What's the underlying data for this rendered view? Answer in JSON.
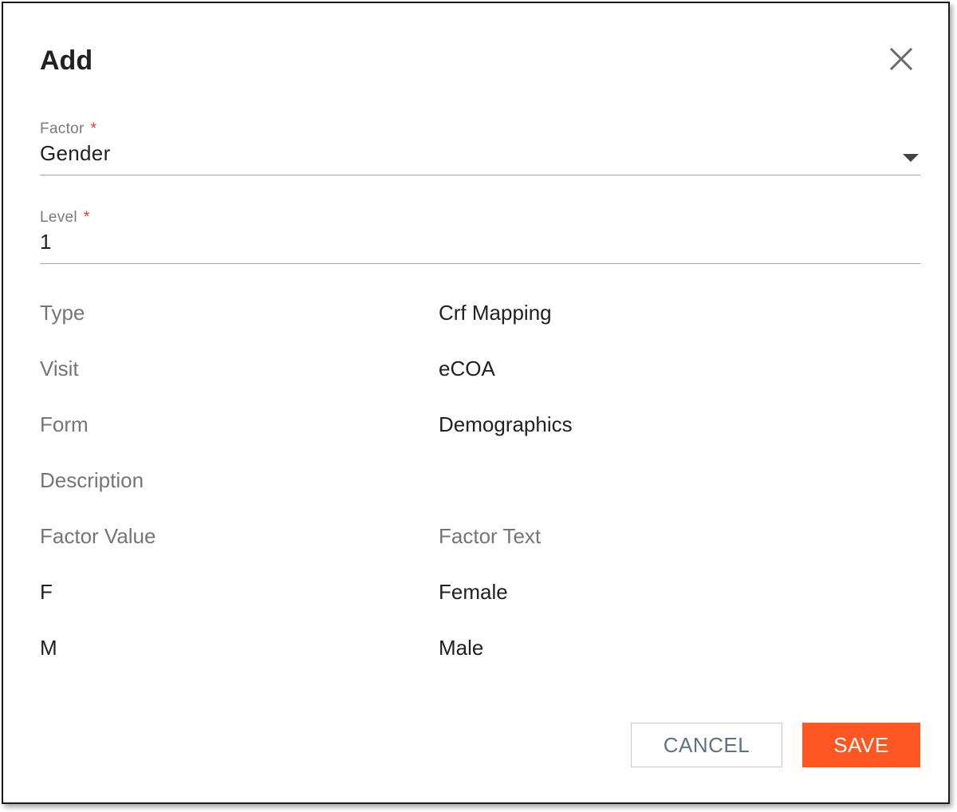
{
  "dialog": {
    "title": "Add",
    "close_icon": "close-icon"
  },
  "factor_field": {
    "label": "Factor",
    "required_mark": "*",
    "value": "Gender",
    "dropdown_icon": "caret-down-icon"
  },
  "level_field": {
    "label": "Level",
    "required_mark": "*",
    "value": "1"
  },
  "details": [
    {
      "label": "Type",
      "value": "Crf Mapping"
    },
    {
      "label": "Visit",
      "value": "eCOA"
    },
    {
      "label": "Form",
      "value": "Demographics"
    },
    {
      "label": "Description",
      "value": ""
    }
  ],
  "factor_table": {
    "headers": {
      "value": "Factor Value",
      "text": "Factor Text"
    },
    "rows": [
      {
        "value": "F",
        "text": "Female"
      },
      {
        "value": "M",
        "text": "Male"
      }
    ]
  },
  "actions": {
    "cancel_label": "CANCEL",
    "save_label": "SAVE"
  },
  "colors": {
    "save_button": "#ff5722",
    "required_mark": "#e53935",
    "cancel_text": "#5f7480"
  }
}
